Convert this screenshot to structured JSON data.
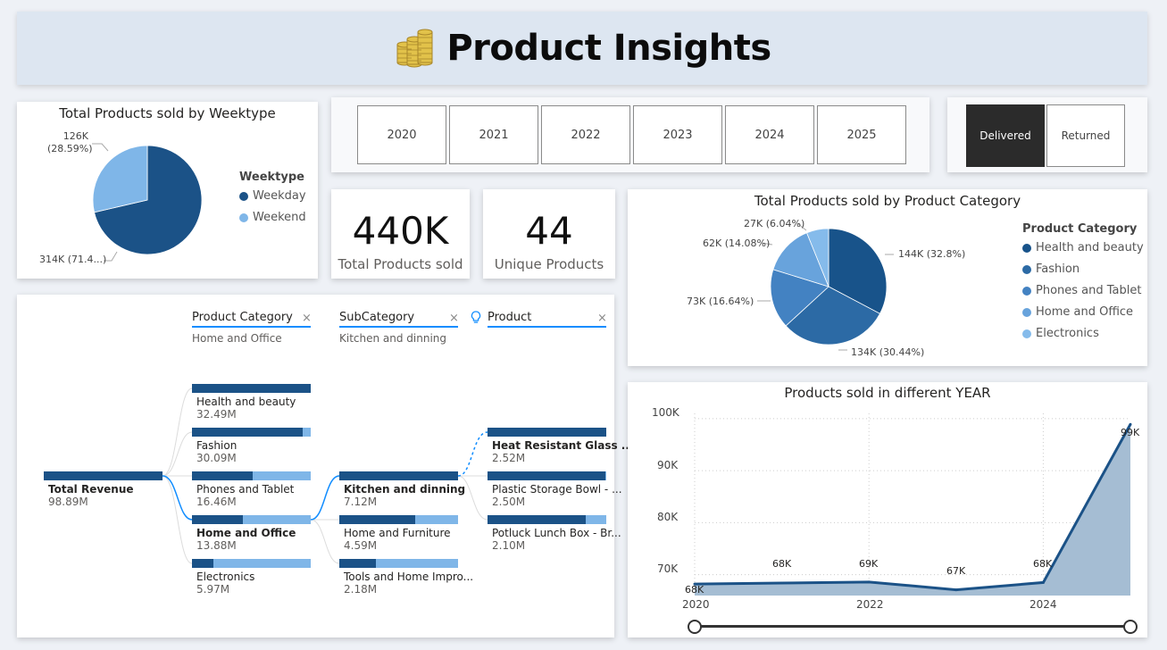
{
  "header": {
    "title": "Product Insights",
    "icon": "coins-icon"
  },
  "weektype_chart": {
    "title": "Total Products sold by Weektype",
    "legend_title": "Weektype",
    "labels": {
      "weekend": "126K\n(28.59%)",
      "weekday": "314K (71.4...)"
    },
    "chart_data": {
      "type": "pie",
      "title": "Total Products sold by Weektype",
      "categories": [
        "Weekday",
        "Weekend"
      ],
      "values": [
        314,
        126
      ],
      "percentages": [
        71.41,
        28.59
      ],
      "colors": [
        "#1b5287",
        "#7fb6e8"
      ]
    }
  },
  "year_slicer": {
    "years": [
      "2020",
      "2021",
      "2022",
      "2023",
      "2024",
      "2025"
    ]
  },
  "status_slicer": {
    "options": [
      "Delivered",
      "Returned"
    ],
    "selected": "Delivered"
  },
  "kpis": [
    {
      "value": "440K",
      "label": "Total Products sold"
    },
    {
      "value": "44",
      "label": "Unique Products"
    }
  ],
  "category_chart": {
    "title": "Total Products sold by Product Category",
    "legend_title": "Product Category",
    "labels": [
      "144K (32.8%)",
      "134K (30.44%)",
      "73K (16.64%)",
      "62K (14.08%)",
      "27K (6.04%)"
    ],
    "chart_data": {
      "type": "pie",
      "title": "Total Products sold by Product Category",
      "categories": [
        "Health and beauty",
        "Fashion",
        "Phones and Tablet",
        "Home and Office",
        "Electronics"
      ],
      "values": [
        144,
        134,
        73,
        62,
        27
      ],
      "percentages": [
        32.8,
        30.44,
        16.64,
        14.08,
        6.04
      ],
      "colors": [
        "#18538a",
        "#2c6aa5",
        "#4382c2",
        "#68a3dc",
        "#85bbeb"
      ]
    }
  },
  "decomp_tree": {
    "headers": [
      {
        "label": "Product Category",
        "selection": "Home and Office"
      },
      {
        "label": "SubCategory",
        "selection": "Kitchen and dinning"
      },
      {
        "label": "Product",
        "selection": ""
      }
    ],
    "root": {
      "label": "Total Revenue",
      "value": "98.89M"
    },
    "level1": [
      {
        "label": "Health and beauty",
        "value": "32.49M",
        "fraction": 1.0
      },
      {
        "label": "Fashion",
        "value": "30.09M",
        "fraction": 0.93
      },
      {
        "label": "Phones and Tablet",
        "value": "16.46M",
        "fraction": 0.51
      },
      {
        "label": "Home and Office",
        "value": "13.88M",
        "fraction": 0.43
      },
      {
        "label": "Electronics",
        "value": "5.97M",
        "fraction": 0.18
      }
    ],
    "level2": [
      {
        "label": "Kitchen and dinning",
        "value": "7.12M",
        "fraction": 1.0
      },
      {
        "label": "Home and Furniture",
        "value": "4.59M",
        "fraction": 0.64
      },
      {
        "label": "Tools and Home Impro...",
        "value": "2.18M",
        "fraction": 0.31
      }
    ],
    "level3": [
      {
        "label": "Heat Resistant Glass ...",
        "value": "2.52M",
        "fraction": 1.0
      },
      {
        "label": "Plastic Storage Bowl - ...",
        "value": "2.50M",
        "fraction": 0.99
      },
      {
        "label": "Potluck Lunch Box - Br...",
        "value": "2.10M",
        "fraction": 0.83
      }
    ]
  },
  "year_chart": {
    "title": "Products sold in different YEAR",
    "y_ticks": [
      "100K",
      "90K",
      "80K",
      "70K"
    ],
    "x_ticks": [
      "2020",
      "2022",
      "2024"
    ],
    "data_labels": [
      "68K",
      "68K",
      "69K",
      "67K",
      "68K",
      "99K"
    ],
    "chart_data": {
      "type": "area",
      "title": "Products sold in different YEAR",
      "x": [
        2020,
        2021,
        2022,
        2023,
        2024,
        2025
      ],
      "values": [
        68.2,
        68.4,
        68.6,
        67.1,
        68.5,
        98.9
      ],
      "units": "K",
      "ylim": [
        66,
        101
      ],
      "grid": true
    }
  }
}
